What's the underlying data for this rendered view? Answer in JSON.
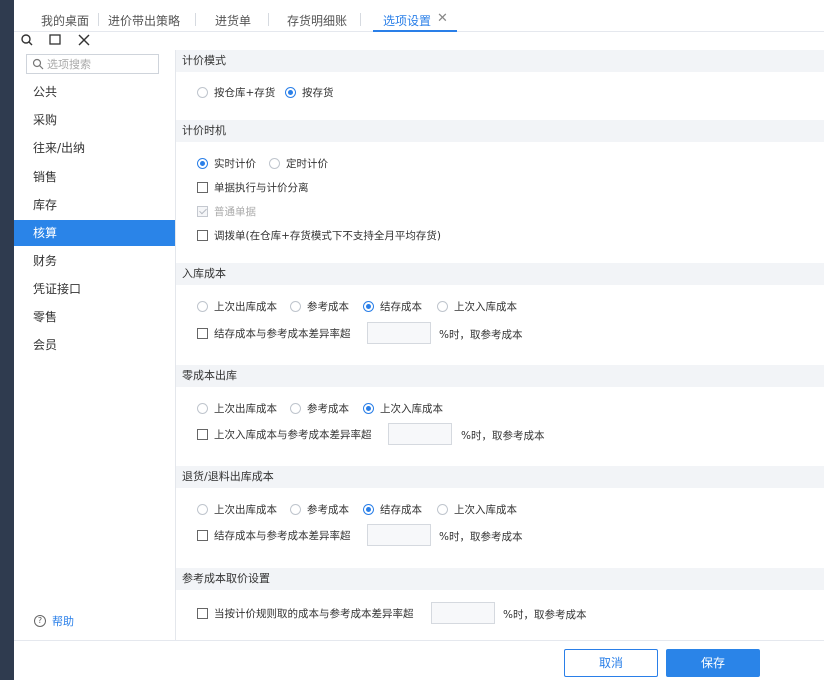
{
  "tabs": [
    {
      "label": "我的桌面"
    },
    {
      "label": "进价带出策略"
    },
    {
      "label": "进货单"
    },
    {
      "label": "存货明细账"
    },
    {
      "label": "选项设置"
    }
  ],
  "toolbar": {
    "icons": [
      "search-icon",
      "maximize-icon",
      "close-icon"
    ]
  },
  "sidebar": {
    "search_placeholder": "选项搜索",
    "items": [
      {
        "label": "公共"
      },
      {
        "label": "采购"
      },
      {
        "label": "往来/出纳"
      },
      {
        "label": "销售"
      },
      {
        "label": "库存"
      },
      {
        "label": "核算"
      },
      {
        "label": "财务"
      },
      {
        "label": "凭证接口"
      },
      {
        "label": "零售"
      },
      {
        "label": "会员"
      }
    ],
    "active_item": "核算",
    "help_label": "帮助"
  },
  "sections": {
    "pricing_mode": {
      "title": "计价模式",
      "options": [
        "按仓库+存货",
        "按存货"
      ],
      "selected": "按存货"
    },
    "pricing_timing": {
      "title": "计价时机",
      "options": [
        "实时计价",
        "定时计价"
      ],
      "selected": "实时计价",
      "check_separate": "单据执行与计价分离",
      "check_normal": "普通单据",
      "check_transfer": "调拨单(在仓库+存货模式下不支持全月平均存货)"
    },
    "inbound_cost": {
      "title": "入库成本",
      "options": [
        "上次出库成本",
        "参考成本",
        "结存成本",
        "上次入库成本"
      ],
      "selected": "结存成本",
      "check_label": "结存成本与参考成本差异率超",
      "suffix": "%时，取参考成本"
    },
    "zero_cost_out": {
      "title": "零成本出库",
      "options": [
        "上次出库成本",
        "参考成本",
        "上次入库成本"
      ],
      "selected": "上次入库成本",
      "check_label": "上次入库成本与参考成本差异率超",
      "suffix": "%时，取参考成本"
    },
    "return_cost": {
      "title": "退货/退料出库成本",
      "options": [
        "上次出库成本",
        "参考成本",
        "结存成本",
        "上次入库成本"
      ],
      "selected": "结存成本",
      "check_label": "结存成本与参考成本差异率超",
      "suffix": "%时，取参考成本"
    },
    "ref_cost": {
      "title": "参考成本取价设置",
      "check_label": "当按计价规则取的成本与参考成本差异率超",
      "suffix": "%时，取参考成本"
    }
  },
  "footer": {
    "cancel_label": "取消",
    "save_label": "保存"
  },
  "colors": {
    "accent": "#2a84e8",
    "sidebar_dark": "#2f3b4f",
    "section_bg": "#f2f4f7"
  }
}
